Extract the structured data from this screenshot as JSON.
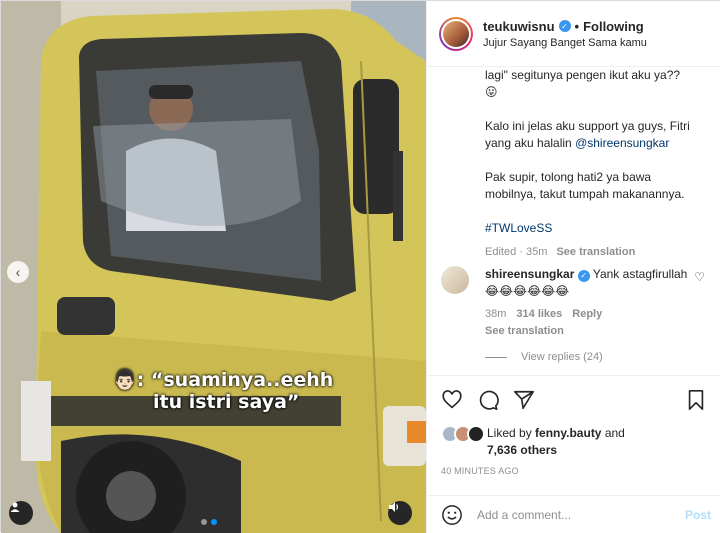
{
  "media": {
    "overlay_line1": ": “suaminya..eehh",
    "overlay_line2": "itu istri saya”",
    "nav_prev_icon": "chevron-left-icon",
    "user_tag_icon": "person-icon",
    "sound_icon": "speaker-icon",
    "truck_color": "#d6c75a"
  },
  "header": {
    "username": "teukuwisnu",
    "follow_status": "Following",
    "subtitle": "Jujur Sayang Banget Sama kamu",
    "separator": "•"
  },
  "caption": {
    "line1": "lagi\" segitunya pengen ikut aku ya??",
    "line1_emoji": "😛",
    "p2_prefix": "Kalo ini jelas aku support ya guys, Fitri yang aku halalin ",
    "mention": "@shireensungkar",
    "p3": "Pak supir, tolong hati2 ya bawa mobilnya, takut tumpah makanannya.",
    "hashtag": "#TWLoveSS",
    "edited": "Edited · 35m",
    "see_translation": "See translation"
  },
  "comment": {
    "username": "shireensungkar",
    "text": "Yank astagfirullah",
    "emojis": "😂😂😂😂😂😂",
    "time": "38m",
    "likes": "314 likes",
    "reply": "Reply",
    "see_translation": "See translation",
    "view_replies": "View replies (24)"
  },
  "likes": {
    "prefix": "Liked by ",
    "user": "fenny.bauty",
    "and": " and",
    "others": "7,636 others"
  },
  "time_ago": "40 MINUTES AGO",
  "add_comment": {
    "placeholder": "Add a comment...",
    "post_label": "Post"
  },
  "colors": {
    "accent_blue": "#0095f6",
    "link": "#00376b",
    "muted": "#8e8e8e"
  }
}
